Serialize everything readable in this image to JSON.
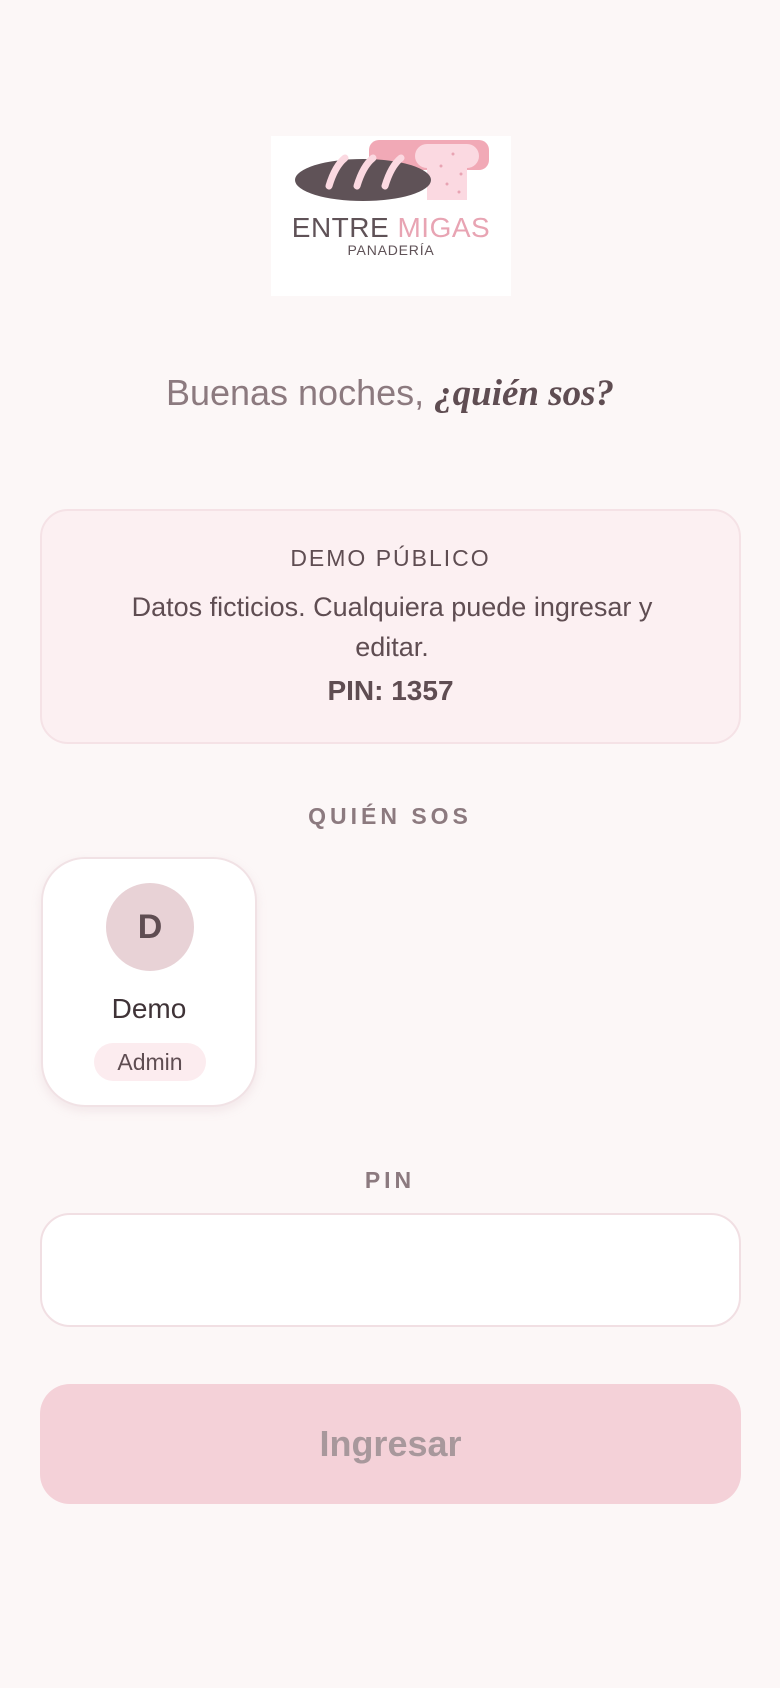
{
  "logo": {
    "brand_part1": "ENTRE",
    "brand_part2": "MIGAS",
    "subtitle": "PANADERÍA",
    "icon": "bread-loaf-icon"
  },
  "greeting": {
    "prefix": "Buenas noches,",
    "accent": "¿quién sos?"
  },
  "demo": {
    "title": "DEMO PÚBLICO",
    "text": "Datos ficticios. Cualquiera puede ingresar y editar.",
    "pin": "PIN: 1357"
  },
  "who": {
    "label": "QUIÉN SOS",
    "users": [
      {
        "initial": "D",
        "name": "Demo",
        "role": "Admin"
      }
    ]
  },
  "pin_field": {
    "label": "PIN",
    "value": ""
  },
  "submit": {
    "label": "Ingresar"
  },
  "colors": {
    "background": "#fcf7f7",
    "accent_pink": "#e8a4b3",
    "button_disabled": "#f4d1d8",
    "text_dark": "#5f4d52"
  }
}
